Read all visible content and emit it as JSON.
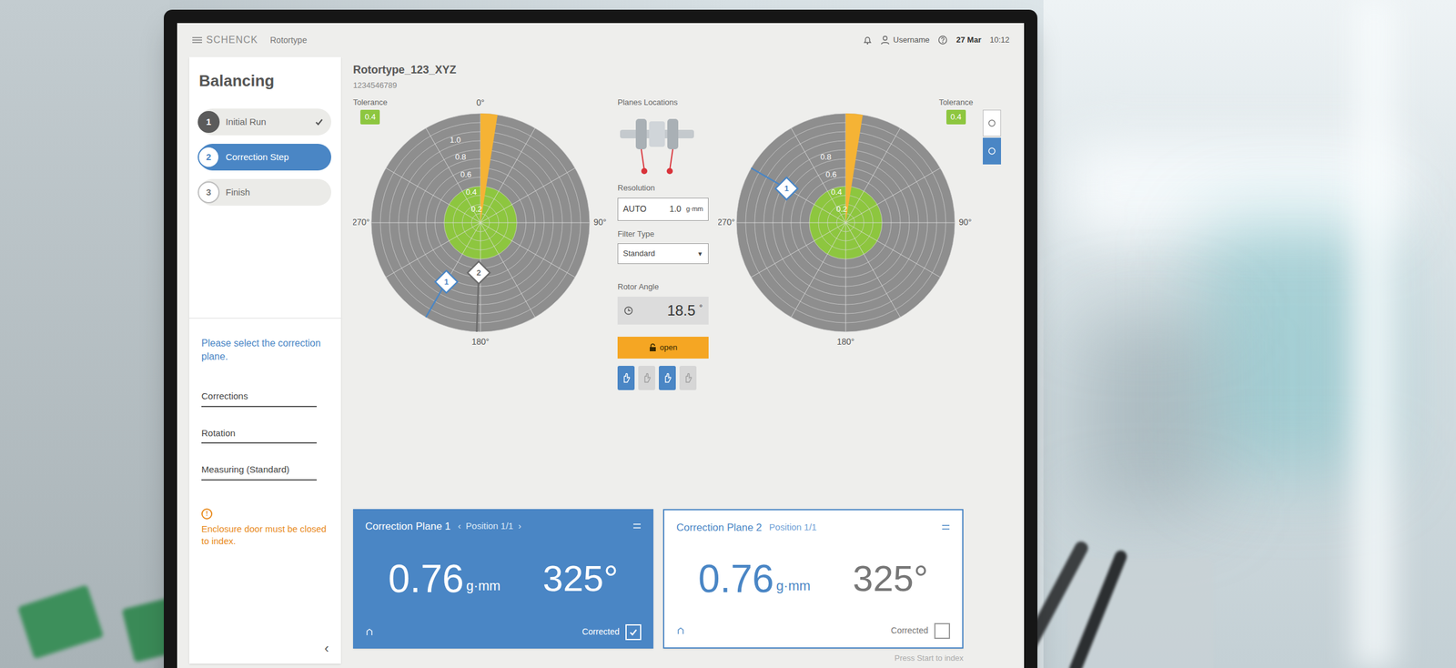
{
  "header": {
    "logo": "SCHENCK",
    "app": "Rotortype",
    "user": "Username",
    "date": "27 Mar",
    "time": "10:12"
  },
  "sidebar": {
    "title": "Balancing",
    "steps": [
      {
        "number": "1",
        "label": "Initial Run",
        "done": true,
        "selected": false
      },
      {
        "number": "2",
        "label": "Correction Step",
        "done": false,
        "selected": true
      },
      {
        "number": "3",
        "label": "Finish",
        "done": false,
        "selected": false
      }
    ],
    "prompt": "Please select the correction plane.",
    "fields": [
      "Corrections",
      "Rotation",
      "Measuring (Standard)"
    ],
    "warning": {
      "icon": "!",
      "text": "Enclosure door must be closed to index."
    },
    "collapse": "‹"
  },
  "rotor": {
    "name": "Rotortype_123_XYZ",
    "id": "1234546789"
  },
  "charts": [
    {
      "tolerance_label": "Tolerance",
      "tolerance": "0.4",
      "tolerance_level": 0.4,
      "max": 1.2,
      "ring_labels": [
        "1.0",
        "0.8",
        "0.6",
        "0.4",
        "0.2"
      ],
      "axis_labels": [
        {
          "text": "0°",
          "angle": 0
        },
        {
          "text": "90°",
          "angle": 90
        },
        {
          "text": "180°",
          "angle": 180
        },
        {
          "text": "270°",
          "angle": 270
        }
      ],
      "sector": [
        0,
        9
      ],
      "markers": [
        {
          "label": "1",
          "angle": 210,
          "value": 0.75,
          "color": "#4a86c5"
        },
        {
          "label": "2",
          "angle": 182,
          "value": 0.55,
          "color": "#6b6b6b"
        }
      ]
    },
    {
      "tolerance_label": "Tolerance",
      "tolerance": "0.4",
      "tolerance_level": 0.4,
      "max": 1.2,
      "ring_labels": [
        "0.8",
        "0.6",
        "0.4",
        "0.2"
      ],
      "axis_labels": [
        {
          "text": "90°",
          "angle": 90
        },
        {
          "text": "180°",
          "angle": 180
        },
        {
          "text": "270°",
          "angle": 270
        }
      ],
      "sector": [
        0,
        9
      ],
      "markers": [
        {
          "label": "1",
          "angle": 300,
          "value": 0.75,
          "color": "#4a86c5"
        }
      ]
    }
  ],
  "center": {
    "planes_label": "Planes Locations",
    "resolution": {
      "label": "Resolution",
      "mode": "AUTO",
      "value": "1.0",
      "unit": "g·mm"
    },
    "filter": {
      "label": "Filter Type",
      "value": "Standard",
      "arrow": "▼"
    },
    "rotor_angle": {
      "label": "Rotor Angle",
      "value": "18.5",
      "unit": "°"
    },
    "door_button": "open",
    "tool_buttons": [
      {
        "selected": true
      },
      {
        "selected": false
      },
      {
        "selected": true
      },
      {
        "selected": false
      }
    ]
  },
  "side_buttons": [
    {
      "selected": false
    },
    {
      "selected": true
    }
  ],
  "correction_planes": [
    {
      "title": "Correction Plane 1",
      "nav": [
        "‹",
        "›"
      ],
      "position": "Position 1/1",
      "amount": "0.76",
      "unit": "g·mm",
      "angle": "325°",
      "status": "Corrected",
      "checked": true,
      "selected": true
    },
    {
      "title": "Correction Plane 2",
      "position": "Position 1/1",
      "amount": "0.76",
      "unit": "g·mm",
      "angle": "325°",
      "status": "Corrected",
      "checked": false,
      "selected": false
    }
  ],
  "hint": "Press Start to index"
}
